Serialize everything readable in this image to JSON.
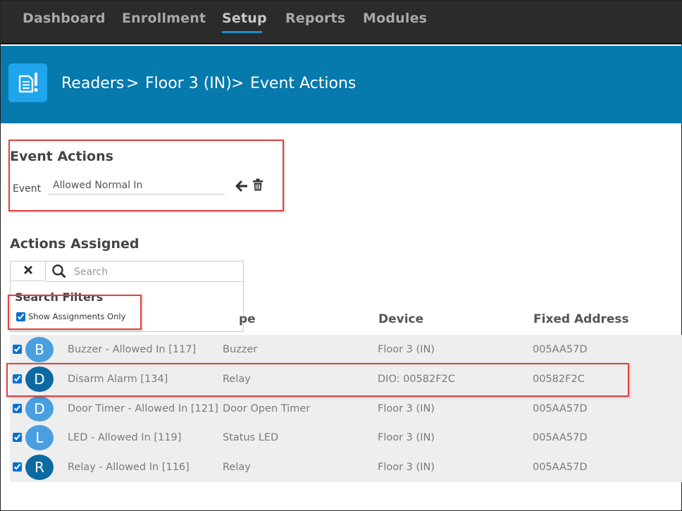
{
  "nav": {
    "items": [
      {
        "label": "Dashboard"
      },
      {
        "label": "Enrollment"
      },
      {
        "label": "Setup"
      },
      {
        "label": "Reports"
      },
      {
        "label": "Modules"
      }
    ]
  },
  "header": {
    "icon": "reader-alert-icon",
    "crumbs": [
      "Readers",
      "Floor 3 (IN)",
      "Event Actions"
    ],
    "separator": ">"
  },
  "event_actions": {
    "title": "Event Actions",
    "event_label": "Event",
    "event_value": "Allowed Normal In"
  },
  "actions_assigned": {
    "title": "Actions Assigned",
    "search_placeholder": "Search",
    "filters_title": "Search Filters",
    "show_assignments_label": "Show Assignments Only"
  },
  "table": {
    "columns": [
      "Type",
      "Device",
      "Fixed Address"
    ],
    "type_column_visible": "pe",
    "rows": [
      {
        "initial": "B",
        "name": "Buzzer - Allowed In [117]",
        "type": "Buzzer",
        "device": "Floor 3 (IN)",
        "address": "005AA57D",
        "color": "#4a9fe0",
        "checked": true
      },
      {
        "initial": "D",
        "name": "Disarm Alarm [134]",
        "type": "Relay",
        "device": "DIO: 00582F2C",
        "address": "00582F2C",
        "color": "#0c6aa1",
        "checked": true
      },
      {
        "initial": "D",
        "name": "Door Timer - Allowed In [121]",
        "type": "Door Open Timer",
        "device": "Floor 3 (IN)",
        "address": "005AA57D",
        "color": "#4a9fe0",
        "checked": true
      },
      {
        "initial": "L",
        "name": "LED - Allowed In [119]",
        "type": "Status LED",
        "device": "Floor 3 (IN)",
        "address": "005AA57D",
        "color": "#4a9fe0",
        "checked": true
      },
      {
        "initial": "R",
        "name": "Relay - Allowed In [116]",
        "type": "Relay",
        "device": "Floor 3 (IN)",
        "address": "005AA57D",
        "color": "#0c6aa1",
        "checked": true
      }
    ]
  },
  "colors": {
    "nav_bg": "#2b2b2b",
    "header_bg": "#0679ad",
    "accent": "#1a8fcf",
    "highlight": "#e0423f"
  }
}
